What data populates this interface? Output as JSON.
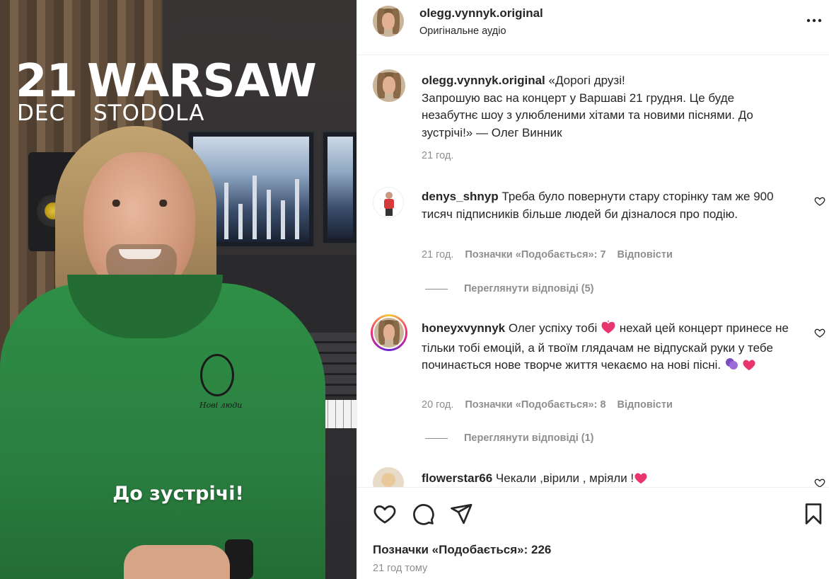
{
  "media": {
    "day": "21",
    "city": "WARSAW",
    "month": "DEC",
    "venue": "STODOLA",
    "caption": "До зустрічі!",
    "hoodie_logo_text": "Нові люди"
  },
  "header": {
    "username": "olegg.vynnyk.original",
    "audio": "Оригінальне аудіо",
    "more_icon": "more-horizontal-icon"
  },
  "post": {
    "username": "olegg.vynnyk.original",
    "text": "«Дорогі друзі!\nЗапрошую вас на концерт у Варшаві 21 грудня. Це буде незабутнє шоу з улюбленими хітами та новими піснями. До зустрічі!» — Олег Винник",
    "time": "21 год."
  },
  "comments": [
    {
      "username": "denys_shnyp",
      "text": "Треба було повернути стару сторінку там же 900 тисяч підписників більше людей би дізналося про подію.",
      "time": "21 год.",
      "likes": "Позначки «Подобається»: 7",
      "reply": "Відповісти",
      "view_replies": "Переглянути відповіді (5)"
    },
    {
      "username": "honeyxvynnyk",
      "text_a": "Олег успіху тобі",
      "text_b": "нехай цей концерт принесе не тільки тобі емоцій, а й твоїм глядачам не відпускай руки у тебе починається нове творче життя чекаємо на нові пісні.",
      "time": "20 год.",
      "likes": "Позначки «Подобається»: 8",
      "reply": "Відповісти",
      "view_replies": "Переглянути відповіді (1)"
    },
    {
      "username": "flowerstar66",
      "text": "Чекали ,вірили , мріяли !"
    }
  ],
  "footer": {
    "likes": "Позначки «Подобається»: 226",
    "time": "21 год тому",
    "icons": [
      "heart-icon",
      "comment-icon",
      "share-icon",
      "bookmark-icon"
    ]
  },
  "colors": {
    "text": "#262626",
    "muted": "#8e8e8e",
    "heart_emoji": "#e8356d",
    "hoodie": "#2e8f46"
  }
}
